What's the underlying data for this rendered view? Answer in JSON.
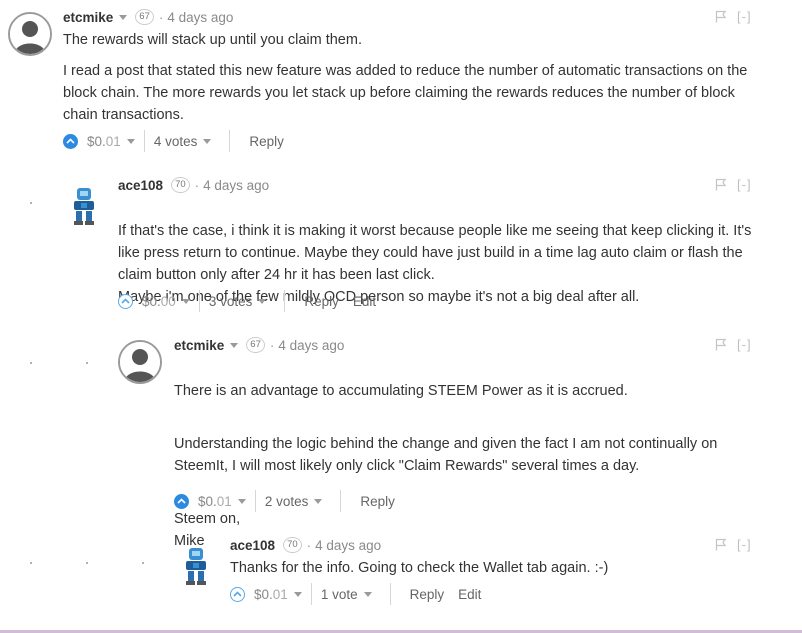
{
  "comments": [
    {
      "author": "etcmike",
      "reputation": "67",
      "separator": "·",
      "time": "4 days ago",
      "paragraphs": [
        "The rewards will stack up until you claim them.",
        "I read a post that stated this new feature was added to reduce the number of automatic transactions on the block chain. The more rewards you let stack up before claiming the rewards reduces the number of block chain transactions."
      ],
      "payout_main": "$0.",
      "payout_cents": "01",
      "votes": "4 votes",
      "reply": "Reply",
      "voted": true,
      "avatar": "default-user-avatar"
    },
    {
      "author": "ace108",
      "reputation": "70",
      "separator": "·",
      "time": "4 days ago",
      "paragraphs": [
        "If that's the case, i think it is making it worst because people like me seeing that keep clicking it. It's like press return to continue. Maybe they could have just build in a time lag auto claim or flash the claim button only after 24 hr it has been last click.\nMaybe i'm one of the few mildly OCD person so maybe it's not a big deal after all."
      ],
      "payout_main": "$0.",
      "payout_cents": "00",
      "votes": "3 votes",
      "reply": "Reply",
      "edit": "Edit",
      "voted": false,
      "avatar": "robot-avatar"
    },
    {
      "author": "etcmike",
      "reputation": "67",
      "separator": "·",
      "time": "4 days ago",
      "paragraphs": [
        "There is an advantage to accumulating STEEM Power as it is accrued.",
        "Understanding the logic behind the change and given the fact I am not continually on SteemIt, I will most likely only click \"Claim Rewards\" several times a day.",
        "Steem on,\nMike"
      ],
      "payout_main": "$0.",
      "payout_cents": "01",
      "votes": "2 votes",
      "reply": "Reply",
      "voted": true,
      "avatar": "default-user-avatar"
    },
    {
      "author": "ace108",
      "reputation": "70",
      "separator": "·",
      "time": "4 days ago",
      "paragraphs": [
        "Thanks for the info. Going to check the Wallet tab again. :-)"
      ],
      "payout_main": "$0.",
      "payout_cents": "01",
      "votes": "1 vote",
      "reply": "Reply",
      "edit": "Edit",
      "voted": false,
      "avatar": "robot-avatar"
    }
  ],
  "collapse_label": "[-]",
  "colors": {
    "upvote_active": "#2c8ae0",
    "upvote_outline": "#5aa7e6",
    "text": "#333333",
    "muted": "#888888"
  }
}
